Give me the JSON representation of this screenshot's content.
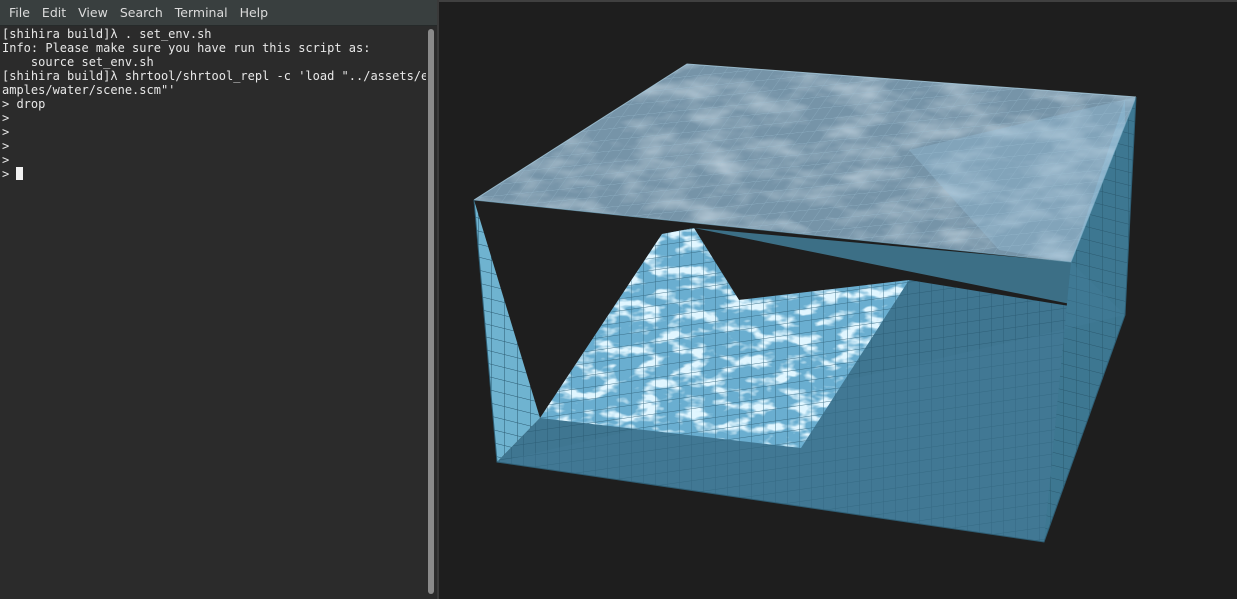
{
  "menubar": {
    "items": [
      {
        "label": "File"
      },
      {
        "label": "Edit"
      },
      {
        "label": "View"
      },
      {
        "label": "Search"
      },
      {
        "label": "Terminal"
      },
      {
        "label": "Help"
      }
    ]
  },
  "terminal": {
    "lines": [
      "[shihira build]λ . set_env.sh",
      "Info: Please make sure you have run this script as:",
      "    source set_env.sh",
      "[shihira build]λ shrtool/shrtool_repl -c 'load \"../assets/ex",
      "amples/water/scene.scm\"'",
      "> drop",
      ">",
      ">",
      ">",
      ">",
      "> "
    ]
  },
  "viewport": {
    "background": "#1e1e1e",
    "water_color": "#5b9bbf",
    "caustic_color": "#bfeaff"
  }
}
